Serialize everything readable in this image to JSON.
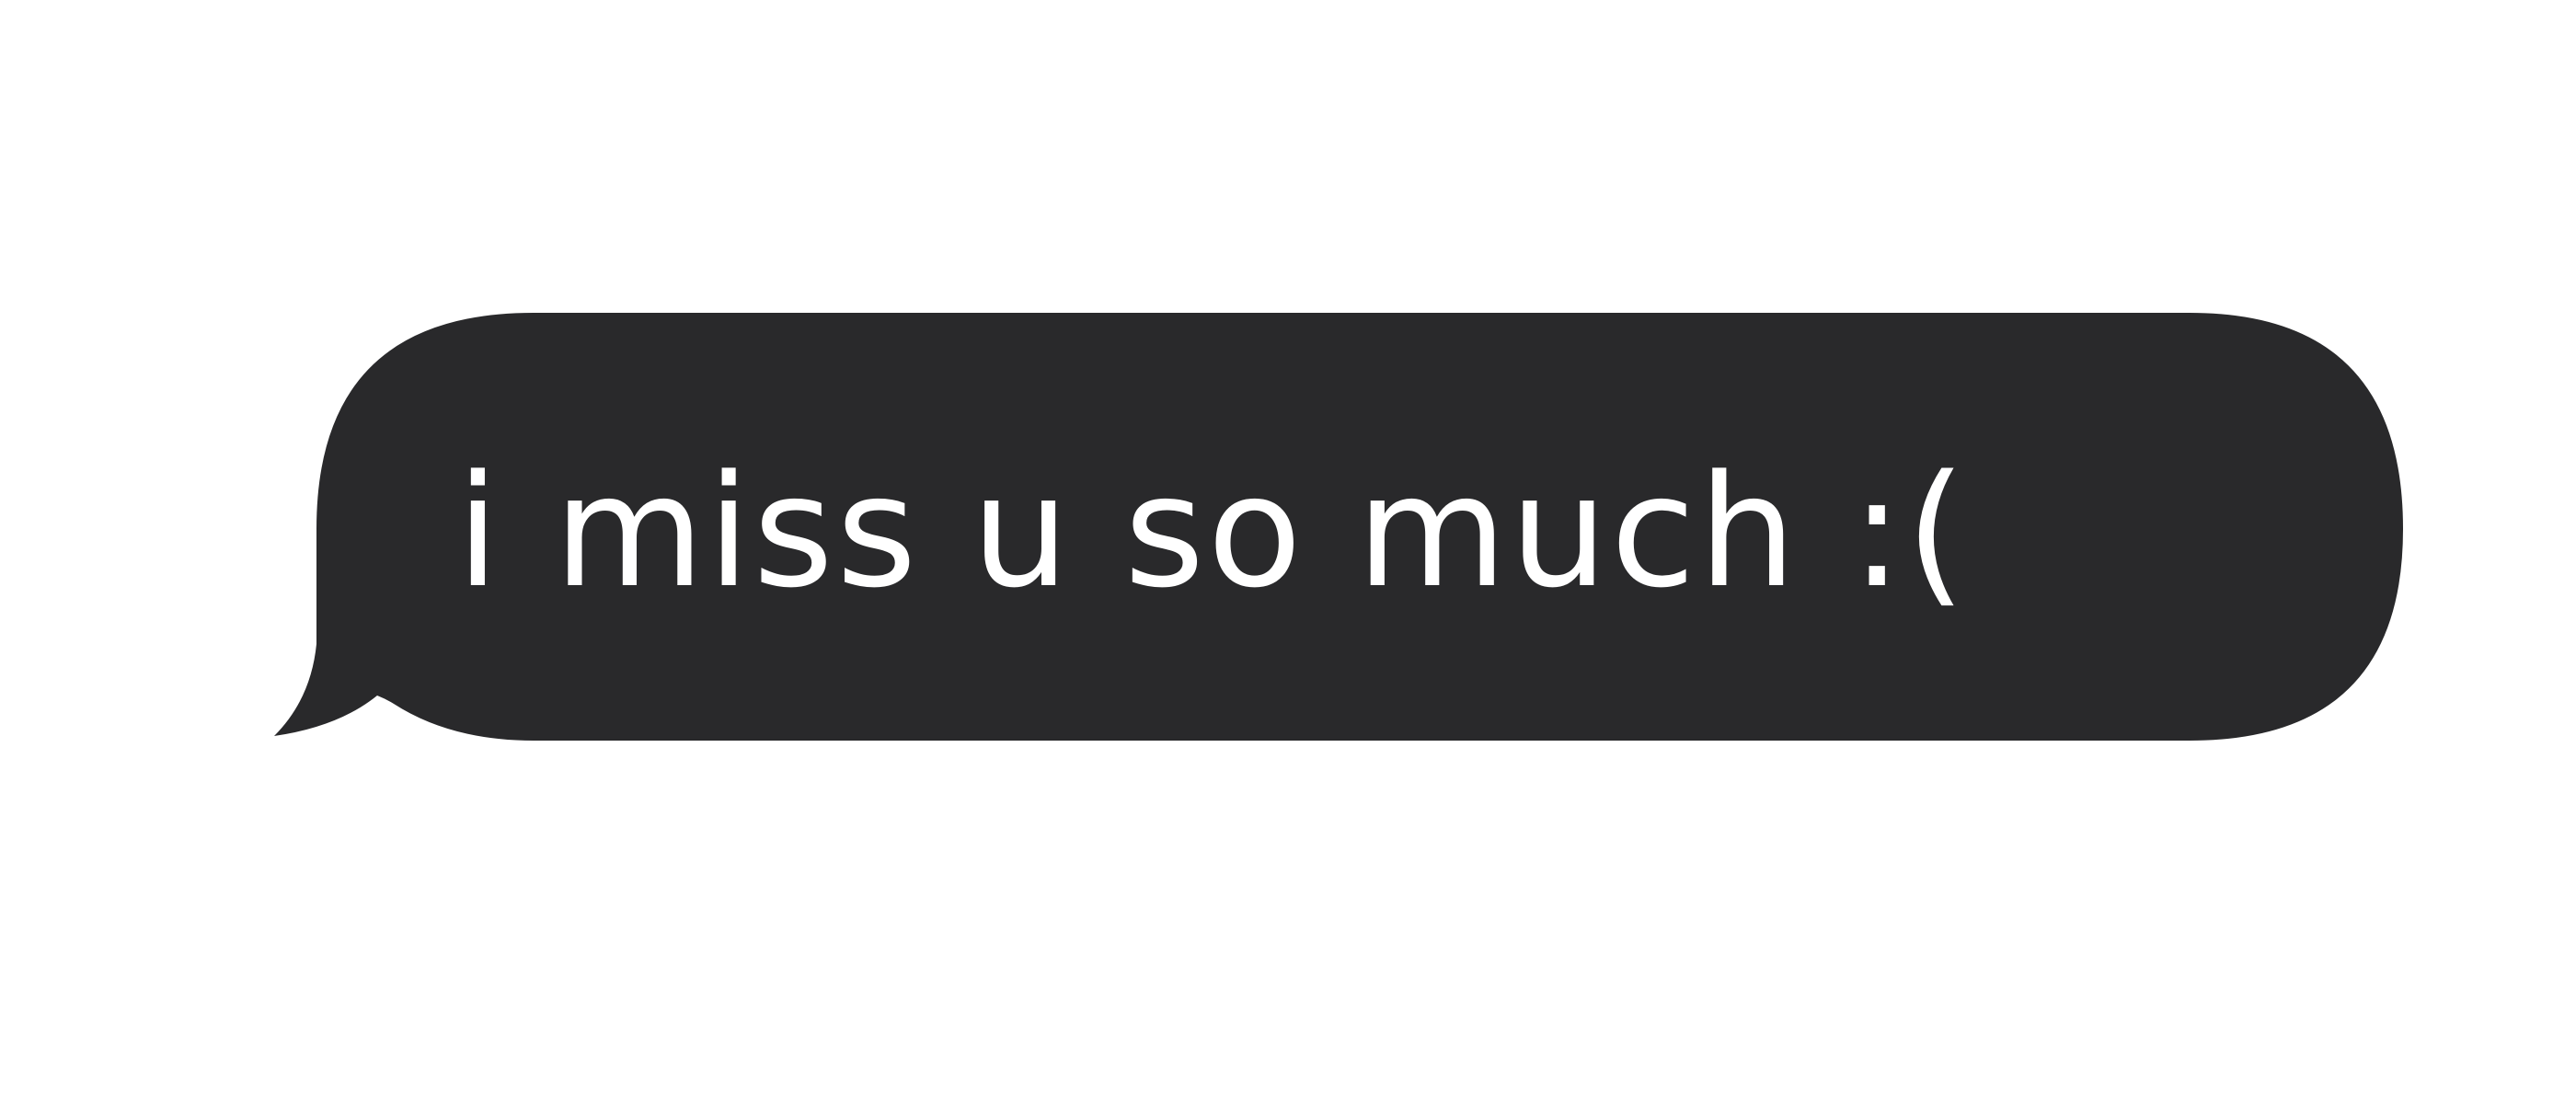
{
  "message": {
    "text": "i miss u so much :(",
    "direction": "received",
    "bubble_color": "#29292b",
    "text_color": "#ffffff"
  }
}
